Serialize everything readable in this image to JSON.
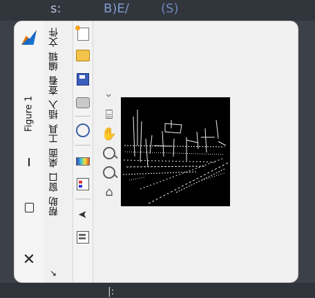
{
  "background": {
    "code_fragments": [
      "s:",
      "B)E/",
      "(S)",
      "|:"
    ]
  },
  "window": {
    "title": "Figure 1",
    "minimize_symbol": "—",
    "close_symbol": "✕"
  },
  "menu": {
    "items": [
      "文件",
      "编辑",
      "查看",
      "插入",
      "工具",
      "桌面",
      "窗口",
      "帮助"
    ],
    "overflow_symbol": "↘"
  },
  "toolbar": {
    "icons": [
      "new-figure-icon",
      "open-file-icon",
      "save-icon",
      "print-icon",
      "link-plot-icon",
      "insert-colorbar-icon",
      "insert-legend-icon",
      "edit-plot-icon",
      "open-property-inspector-icon"
    ]
  },
  "axes_toolbar": {
    "expand_symbol": "›",
    "icons": [
      "data-tips-icon",
      "pan-icon",
      "zoom-in-icon",
      "zoom-out-icon",
      "restore-view-icon"
    ]
  },
  "plot": {
    "content": "edge detection binary image",
    "colors": {
      "background": "#000000",
      "edges": "#ffffff"
    }
  }
}
